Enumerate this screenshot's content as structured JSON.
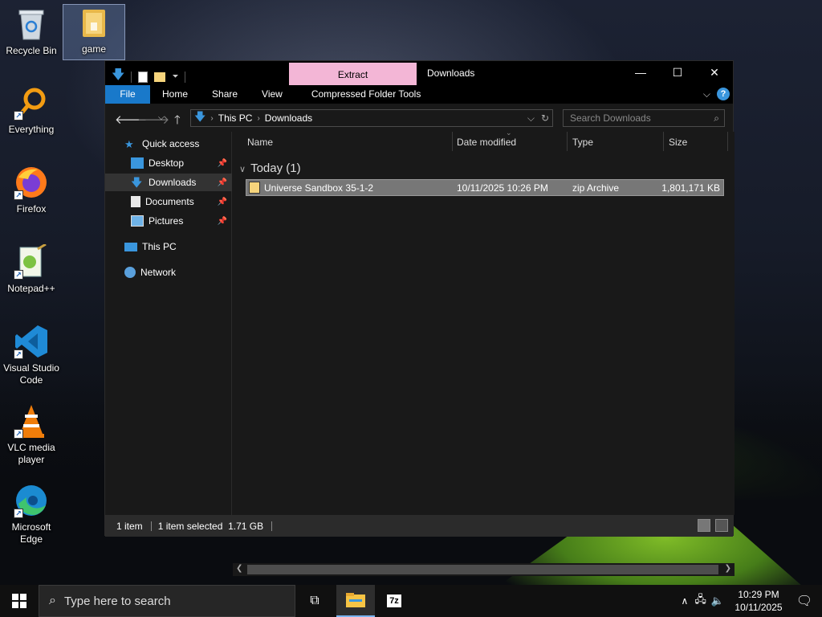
{
  "desktop": {
    "icons": [
      {
        "label": "Recycle Bin",
        "icon": "recycle-bin-icon"
      },
      {
        "label": "game",
        "icon": "folder-icon"
      },
      {
        "label": "Everything",
        "icon": "everything-search-icon"
      },
      {
        "label": "Firefox",
        "icon": "firefox-icon"
      },
      {
        "label": "Notepad++",
        "icon": "notepadpp-icon"
      },
      {
        "label": "Visual Studio Code",
        "icon": "vscode-icon"
      },
      {
        "label": "VLC media player",
        "icon": "vlc-icon"
      },
      {
        "label": "Microsoft Edge",
        "icon": "edge-icon"
      }
    ]
  },
  "window": {
    "title": "Downloads",
    "contextual_tab": "Extract",
    "ribbon_tabs": [
      "File",
      "Home",
      "Share",
      "View",
      "Compressed Folder Tools"
    ],
    "controls": {
      "minimize": "—",
      "maximize": "☐",
      "close": "✕"
    }
  },
  "address": {
    "crumbs": [
      "This PC",
      "Downloads"
    ],
    "search_placeholder": "Search Downloads"
  },
  "navpane": {
    "quick_access": "Quick access",
    "items": [
      {
        "label": "Desktop",
        "pinned": true
      },
      {
        "label": "Downloads",
        "pinned": true
      },
      {
        "label": "Documents",
        "pinned": true
      },
      {
        "label": "Pictures",
        "pinned": true
      }
    ],
    "this_pc": "This PC",
    "network": "Network"
  },
  "content": {
    "columns": [
      "Name",
      "Date modified",
      "Type",
      "Size"
    ],
    "group": "Today (1)",
    "files": [
      {
        "name": "Universe Sandbox 35-1-2",
        "date": "10/11/2025 10:26 PM",
        "type": "zip Archive",
        "size": "1,801,171 KB"
      }
    ]
  },
  "status": {
    "item_count": "1 item",
    "selection": "1 item selected  1.71 GB"
  },
  "taskbar": {
    "search_placeholder": "Type here to search",
    "time": "10:29 PM",
    "date": "10/11/2025"
  },
  "colors": {
    "accent": "#1979ca",
    "extract_tab": "#f3b6d6",
    "window_bg": "#191919"
  }
}
